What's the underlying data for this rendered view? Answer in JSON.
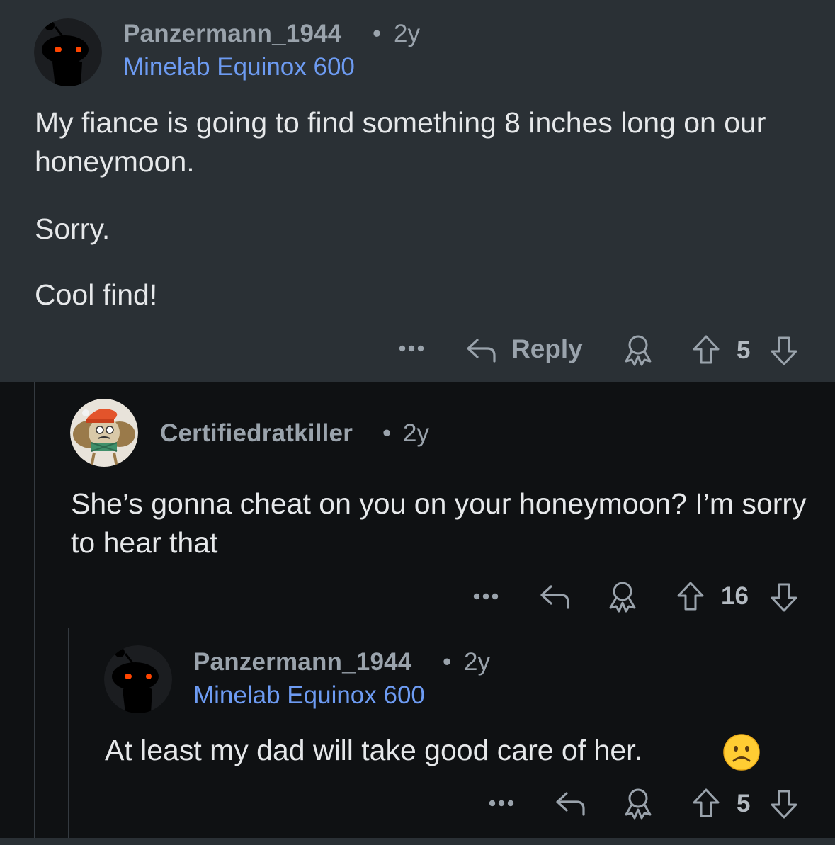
{
  "comments": [
    {
      "username": "Panzermann_1944",
      "separator": "•",
      "age": "2y",
      "flair": "Minelab Equinox 600",
      "body": [
        "My fiance is going to find something 8 inches long on our honeymoon.",
        "Sorry.",
        "Cool find!"
      ],
      "actions": {
        "more_icon": "more-dots-icon",
        "reply_label": "Reply",
        "award_icon": "award-icon",
        "score": "5"
      }
    },
    {
      "username": "Certifiedratkiller",
      "separator": "•",
      "age": "2y",
      "body": [
        "She’s gonna cheat on you on your honeymoon? I’m sorry to hear that"
      ],
      "actions": {
        "score": "16"
      }
    },
    {
      "username": "Panzermann_1944",
      "separator": "•",
      "age": "2y",
      "flair": "Minelab Equinox 600",
      "body": [
        "At least my dad will take good care of her."
      ],
      "emoji": "frowning-face-emoji",
      "actions": {
        "score": "5"
      }
    }
  ],
  "colors": {
    "highlight_bg": "#2a3035",
    "page_bg": "#0f1113",
    "flair": "#6d9bf2",
    "meta": "#9aa3ac",
    "body": "#e6e8ea"
  }
}
